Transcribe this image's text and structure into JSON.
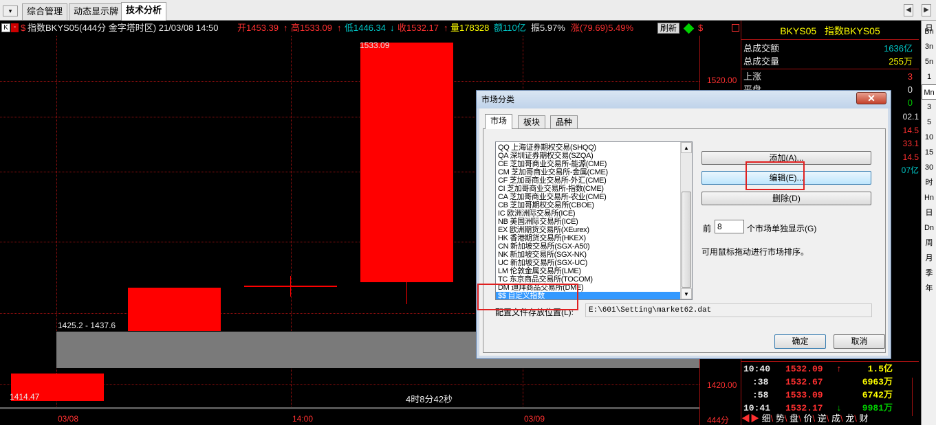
{
  "tabs": [
    "综合管理",
    "动态显示牌",
    "技术分析"
  ],
  "header": {
    "k_button": "K",
    "minus_button": "-",
    "dollar": "$",
    "title": "指数BKYS05(444分 金字塔时区) 21/03/08 14:50",
    "open": "开1453.39",
    "open_arrow": "↑",
    "high": "高1533.09",
    "high_arrow": "↑",
    "low": "低1446.34",
    "low_arrow": "↓",
    "close": "收1532.17",
    "close_arrow": "↑",
    "volume": "量178328",
    "amount": "额110亿",
    "amplitude": "振5.97%",
    "change": "涨(79.69)5.49%",
    "refresh": "刷新"
  },
  "chart": {
    "labels": {
      "high_marker": "1533.09",
      "low_marker": "1414.47",
      "range_label": "1425.2 - 1437.6",
      "countdown": "4时8分42秒",
      "price_1520": "1520.00",
      "price_1420": "1420.00",
      "x_0308": "03/08",
      "x_1400": "14:00",
      "x_0309": "03/09",
      "period": "444分"
    },
    "partial_right_prices": [
      "02.1",
      "14.5",
      "33.1",
      "14.5",
      "07亿"
    ]
  },
  "right_panel": {
    "title_code": "BKYS05",
    "title_name": "指数BKYS05",
    "total_amount_label": "总成交额",
    "total_amount_value": "1636亿",
    "total_volume_label": "总成交量",
    "total_volume_value": "255万",
    "up_label": "上涨",
    "up_value": "3",
    "flat_label": "平盘",
    "flat_value": "0",
    "down_value": "0",
    "ticks": [
      {
        "time": "10:40",
        "price": "1532.09",
        "arrow": "↑",
        "vol": "1.5亿"
      },
      {
        "time": ":38",
        "price": "1532.67",
        "arrow": "",
        "vol": "6963万"
      },
      {
        "time": ":58",
        "price": "1533.09",
        "arrow": "",
        "vol": "6742万"
      },
      {
        "time": "10:41",
        "price": "1532.17",
        "arrow": "↓",
        "vol": "9981万"
      }
    ],
    "bottom_tabs": [
      "细",
      "势",
      "盘",
      "价",
      "逆",
      "成",
      "龙",
      "财"
    ]
  },
  "right_strip": [
    "日",
    "Bn",
    "3n",
    "5n",
    "1",
    "Mn",
    "3",
    "5",
    "10",
    "15",
    "30",
    "时",
    "Hn",
    "日",
    "Dn",
    "周",
    "月",
    "季",
    "年"
  ],
  "dialog": {
    "title": "市场分类",
    "close": "✕",
    "tabs": [
      "市场",
      "板块",
      "品种"
    ],
    "markets": [
      "QQ 上海证券期权交易(SHQQ)",
      "QA 深圳证券期权交易(SZQA)",
      "CE 芝加哥商业交易所-能源(CME)",
      "CM 芝加哥商业交易所-金属(CME)",
      "CF 芝加哥商业交易所-外汇(CME)",
      "CI 芝加哥商业交易所-指数(CME)",
      "CA 芝加哥商业交易所-农业(CME)",
      "CB 芝加哥期权交易所(CBOE)",
      "IC 欧洲洲际交易所(ICE)",
      "NB 美国洲际交易所(ICE)",
      "EX 欧洲期货交易所(XEurex)",
      "HK 香港期货交易所(HKEX)",
      "CN 新加坡交易所(SGX-A50)",
      "NK 新加坡交易所(SGX-NK)",
      "UC 新加坡交易所(SGX-UC)",
      "LM 伦敦金属交易所(LME)",
      "TC 东京商品交易所(TOCOM)",
      "DM 迪拜商品交易所(DME)",
      "$$ 自定义指数"
    ],
    "selected_index": 18,
    "add_button": "添加(A)...",
    "edit_button": "编辑(E)...",
    "delete_button": "删除(D)",
    "front_label": "前",
    "front_value": "8",
    "front_suffix": "个市场单独显示(G)",
    "drag_hint": "可用鼠标拖动进行市场排序。",
    "config_label": "配置文件存放位置(L):",
    "config_path": "E:\\601\\Setting\\market62.dat",
    "ok_button": "确定",
    "cancel_button": "取消"
  },
  "colors": {
    "up": "#ff0000",
    "down": "#00d000",
    "selection": "#3399ff",
    "highlight_box": "#e02020"
  }
}
